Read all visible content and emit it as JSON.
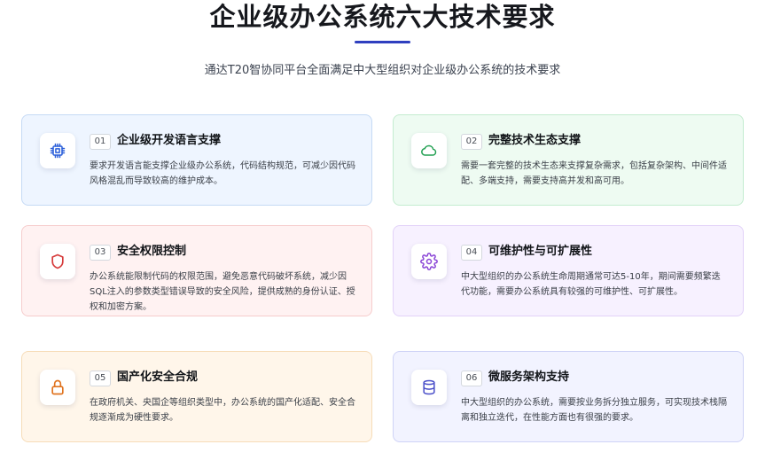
{
  "header": {
    "title": "企业级办公系统六大技术要求",
    "subtitle": "通达T20智协同平台全面满足中大型组织对企业级办公系统的技术要求"
  },
  "cards": [
    {
      "number": "01",
      "title": "企业级开发语言支撑",
      "description": "要求开发语言能支撑企业级办公系统，代码结构规范，可减少因代码风格混乱而导致较高的维护成本。",
      "icon": "chip-icon",
      "accent": "#2b5fd9"
    },
    {
      "number": "02",
      "title": "完整技术生态支撑",
      "description": "需要一套完整的技术生态来支撑复杂需求，包括复杂架构、中间件适配、多端支持，需要支持高并发和高可用。",
      "icon": "cloud-icon",
      "accent": "#22a052"
    },
    {
      "number": "03",
      "title": "安全权限控制",
      "description": "办公系统能限制代码的权限范围，避免恶意代码破坏系统，减少因SQL注入的参数类型错误导致的安全风险，提供成熟的身份认证、授权和加密方案。",
      "icon": "shield-icon",
      "accent": "#d63b3b"
    },
    {
      "number": "04",
      "title": "可维护性与可扩展性",
      "description": "中大型组织的办公系统生命周期通常可达5-10年，期间需要频繁迭代功能，需要办公系统具有较强的可维护性、可扩展性。",
      "icon": "gear-icon",
      "accent": "#8a45d6"
    },
    {
      "number": "05",
      "title": "国产化安全合规",
      "description": "在政府机关、央国企等组织类型中，办公系统的国产化适配、安全合规逐渐成为硬性要求。",
      "icon": "lock-icon",
      "accent": "#e0731f"
    },
    {
      "number": "06",
      "title": "微服务架构支持",
      "description": "中大型组织的办公系统，需要按业务拆分独立服务，可实现技术栈隔离和独立迭代，在性能方面也有很强的要求。",
      "icon": "database-icon",
      "accent": "#4a4fc9"
    }
  ],
  "colors": {
    "title_underline": "#2f3fbf"
  }
}
